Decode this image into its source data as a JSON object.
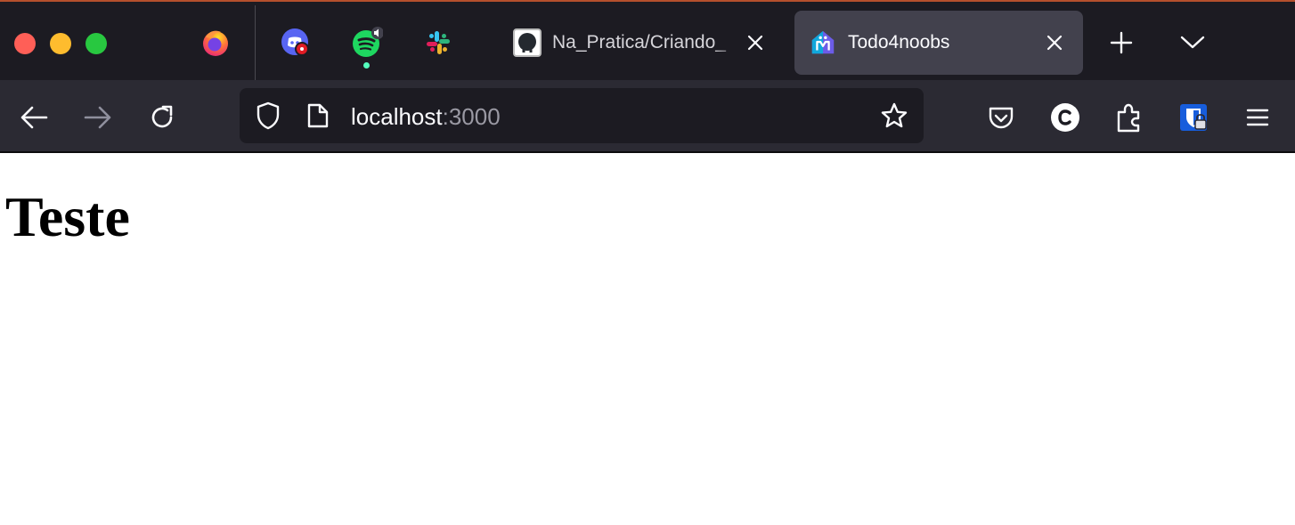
{
  "window": {
    "controls": [
      "close",
      "minimize",
      "zoom"
    ]
  },
  "pinned_tabs": [
    {
      "icon": "firefox-icon"
    },
    {
      "icon": "discord-icon",
      "badge": "notification"
    },
    {
      "icon": "spotify-icon",
      "indicator": "playing-audio"
    },
    {
      "icon": "slack-icon"
    }
  ],
  "tabs": [
    {
      "title": "Na_Pratica/Criando_",
      "icon": "github-icon",
      "active": false
    },
    {
      "title": "Todo4noobs",
      "icon": "todo4noobs-logo-icon",
      "active": true
    }
  ],
  "toolbar": {
    "url_host": "localhost",
    "url_port": ":3000"
  },
  "page": {
    "heading": "Teste"
  },
  "colors": {
    "tabstrip_bg": "#1c1b22",
    "navbar_bg": "#2b2a33",
    "active_tab_bg": "#42414d",
    "urlbar_bg": "#1c1b22",
    "text_light": "#fbfbfe"
  }
}
